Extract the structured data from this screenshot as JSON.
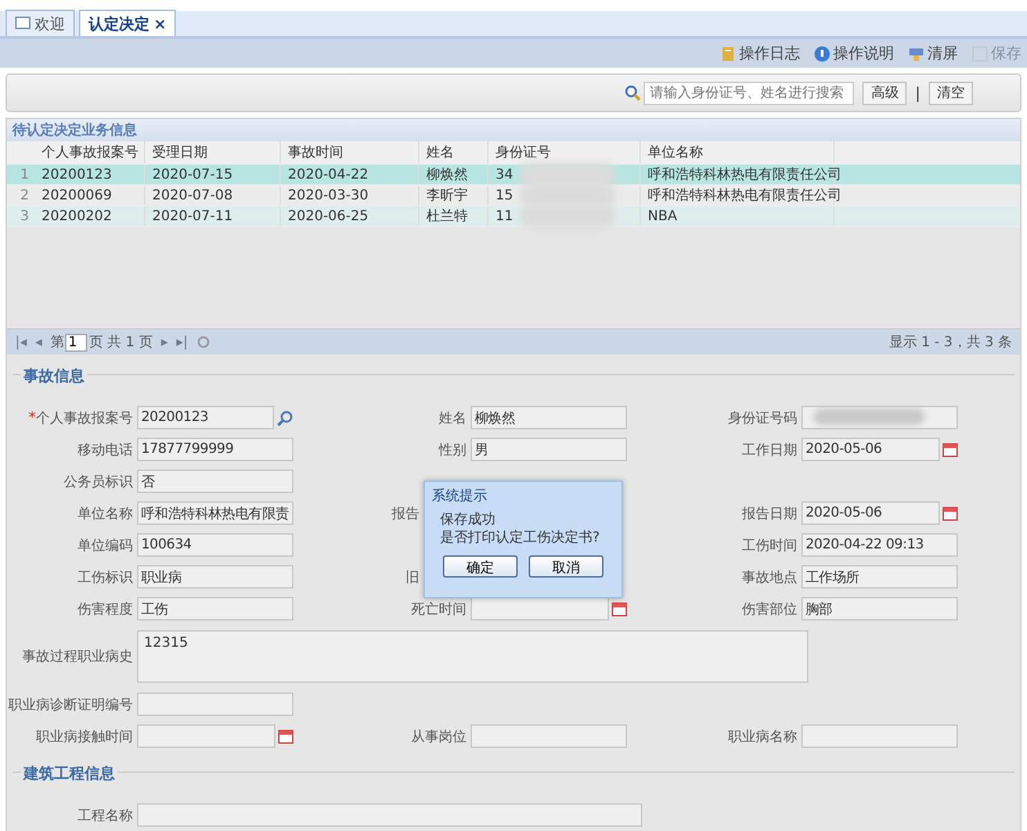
{
  "tabs": [
    {
      "label": "欢迎",
      "selected": false,
      "closable": false
    },
    {
      "label": "认定决定",
      "selected": true,
      "closable": true,
      "close": "×"
    }
  ],
  "toolbar": [
    {
      "label": "操作日志",
      "disabled": false
    },
    {
      "label": "操作说明",
      "disabled": false
    },
    {
      "label": "清屏",
      "disabled": false
    },
    {
      "label": "保存",
      "disabled": true
    }
  ],
  "search": {
    "placeholder": "请输入身份证号、姓名进行搜索",
    "buttons": [
      "高级",
      "清空"
    ],
    "separator": "|"
  },
  "grid": {
    "title": "待认定决定业务信息",
    "columns": [
      "个人事故报案号",
      "受理日期",
      "事故时间",
      "姓名",
      "身份证号",
      "单位名称"
    ],
    "rows": [
      {
        "num": "1",
        "selected": true,
        "cells": [
          "20200123",
          "2020-07-15",
          "2020-04-22",
          "柳焕然",
          "34",
          "呼和浩特科林热电有限责任公司"
        ]
      },
      {
        "num": "2",
        "selected": false,
        "cells": [
          "20200069",
          "2020-07-08",
          "2020-03-30",
          "李昕宇",
          "15",
          "呼和浩特科林热电有限责任公司"
        ]
      },
      {
        "num": "3",
        "selected": false,
        "cells": [
          "20200202",
          "2020-07-11",
          "2020-06-25",
          "杜兰特",
          "11",
          "NBA"
        ]
      }
    ],
    "pager": {
      "first": "|◂",
      "prev": "◂",
      "next": "▸",
      "last": "▸|",
      "page_prefix": "第",
      "page": "1",
      "page_suffix": "页 共 1 页",
      "summary": "显示 1 - 3，共 3 条"
    }
  },
  "accident": {
    "title": "事故信息",
    "rows": [
      [
        {
          "label": "个人事故报案号",
          "required_mark": "*",
          "kind": "search",
          "value": "20200123"
        },
        {
          "label": "姓名",
          "kind": "text",
          "value": "柳焕然"
        },
        {
          "label": "身份证号码",
          "kind": "blurred"
        }
      ],
      [
        {
          "label": "移动电话",
          "kind": "text",
          "value": "17877799999"
        },
        {
          "label": "性别",
          "kind": "text",
          "value": "男"
        },
        {
          "label": "工作日期",
          "kind": "date",
          "value": "2020-05-06"
        }
      ],
      [
        {
          "label": "公务员标识",
          "kind": "text",
          "value": "否"
        }
      ],
      [
        {
          "label": "单位名称",
          "kind": "text",
          "value": "呼和浩特科林热电有限责"
        },
        {
          "label": "报告",
          "kind": "covered"
        },
        {
          "label": "报告日期",
          "kind": "date",
          "value": "2020-05-06"
        }
      ],
      [
        {
          "label": "单位编码",
          "kind": "text",
          "value": "100634"
        },
        {
          "kind": "empty"
        },
        {
          "label": "工伤时间",
          "kind": "text",
          "value": "2020-04-22 09:13"
        }
      ],
      [
        {
          "label": "工伤标识",
          "kind": "text",
          "value": "职业病"
        },
        {
          "label": "旧",
          "kind": "covered"
        },
        {
          "label": "事故地点",
          "kind": "text",
          "value": "工作场所"
        }
      ],
      [
        {
          "label": "伤害程度",
          "kind": "text",
          "value": "工伤"
        },
        {
          "label": "死亡时间",
          "kind": "date"
        },
        {
          "label": "伤害部位",
          "kind": "text",
          "value": "胸部"
        }
      ],
      [
        {
          "label": "事故过程职业病史",
          "kind": "textarea",
          "value": "12315"
        }
      ],
      [
        {
          "label": "职业病诊断证明编号",
          "kind": "text"
        }
      ],
      [
        {
          "label": "职业病接触时间",
          "kind": "date"
        },
        {
          "label": "从事岗位",
          "kind": "text"
        },
        {
          "label": "职业病名称",
          "kind": "text"
        }
      ]
    ]
  },
  "construction": {
    "title": "建筑工程信息",
    "rows": [
      [
        {
          "label": "工程名称",
          "kind": "wide"
        }
      ]
    ]
  },
  "dialog": {
    "title": "系统提示",
    "lines": [
      "保存成功",
      "是否打印认定工伤决定书?"
    ],
    "buttons": [
      "确定",
      "取消"
    ]
  }
}
